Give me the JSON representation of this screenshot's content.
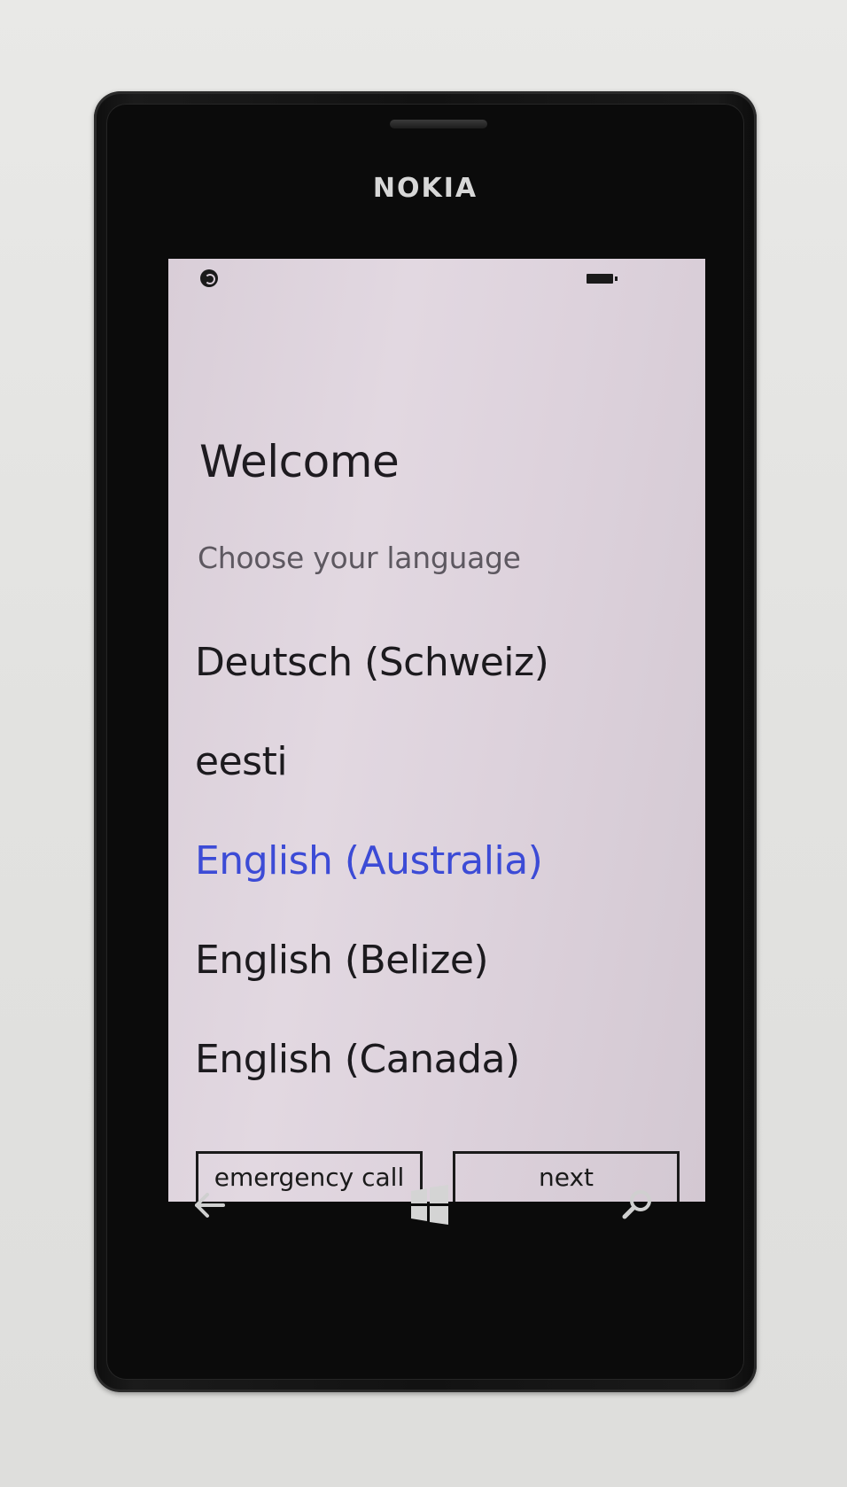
{
  "device": {
    "brand": "NOKIA"
  },
  "status_bar": {
    "left_icon": "network-icon",
    "right_icon": "battery-icon"
  },
  "welcome": {
    "title": "Welcome",
    "subtitle": "Choose your language"
  },
  "languages": [
    {
      "label": "Deutsch (Schweiz)",
      "selected": false
    },
    {
      "label": "eesti",
      "selected": false
    },
    {
      "label": "English (Australia)",
      "selected": true
    },
    {
      "label": "English (Belize)",
      "selected": false
    },
    {
      "label": "English (Canada)",
      "selected": false
    }
  ],
  "buttons": {
    "emergency_call": "emergency call",
    "next": "next"
  },
  "hardware_nav": {
    "back_icon": "back-arrow-icon",
    "start_icon": "windows-logo-icon",
    "search_icon": "search-icon"
  },
  "colors": {
    "accent": "#3c4bd6",
    "screen_background": "#ddd2dc",
    "text": "#1c1a1e"
  }
}
